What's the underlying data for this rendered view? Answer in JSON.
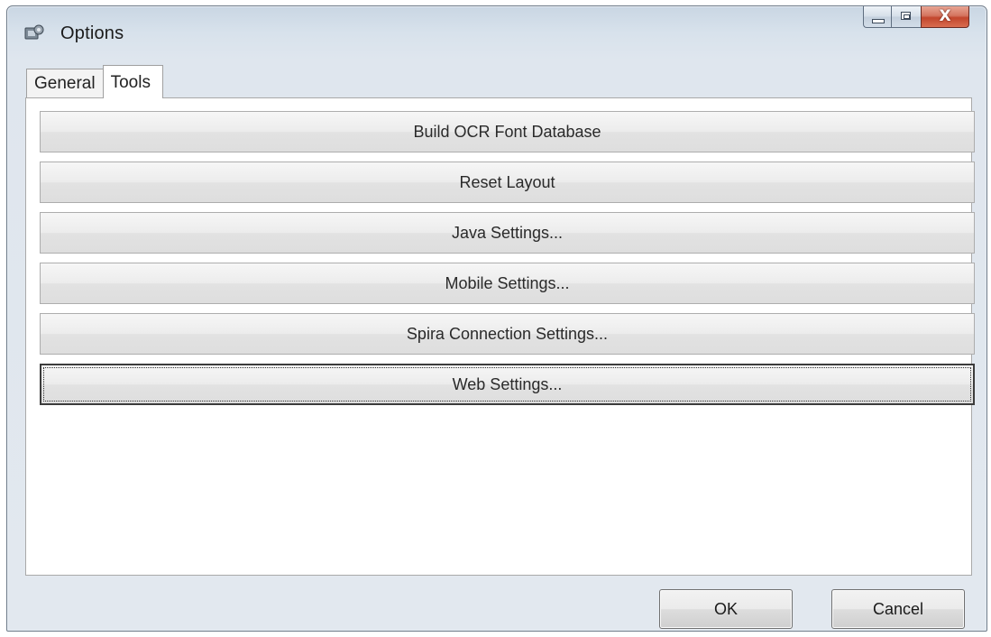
{
  "window": {
    "title": "Options",
    "title_icon": "app-icon",
    "caption": {
      "minimize_icon": "minimize-icon",
      "maximize_icon": "maximize-icon",
      "close_icon": "close-icon",
      "close_glyph": "X"
    }
  },
  "tabs": [
    {
      "label": "General",
      "selected": false
    },
    {
      "label": "Tools",
      "selected": true
    }
  ],
  "tools": {
    "buttons": [
      {
        "label": "Build OCR Font Database"
      },
      {
        "label": "Reset Layout"
      },
      {
        "label": "Java Settings..."
      },
      {
        "label": "Mobile Settings..."
      },
      {
        "label": "Spira Connection Settings..."
      },
      {
        "label": "Web Settings...",
        "focused": true
      }
    ]
  },
  "footer": {
    "ok_label": "OK",
    "cancel_label": "Cancel"
  },
  "colors": {
    "close_button": "#c2462d",
    "window_frame": "#d8e2ec"
  }
}
